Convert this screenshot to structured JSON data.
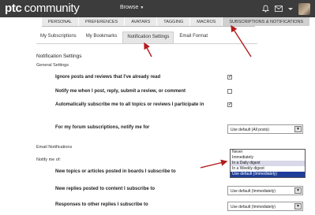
{
  "topbar": {
    "logo_ptc": "ptc",
    "logo_community": "community",
    "browse": "Browse",
    "browse_caret": "▼"
  },
  "subnav": {
    "items": [
      "PERSONAL",
      "PREFERENCES",
      "AVATARS",
      "TAGGING",
      "MACROS",
      "SUBSCRIPTIONS & NOTIFICATIONS"
    ]
  },
  "tabs": {
    "items": [
      "My Subscriptions",
      "My Bookmarks",
      "Notification Settings",
      "Email Format"
    ]
  },
  "notification_settings": {
    "title": "Notification Settings",
    "general": "General Settings",
    "rows": [
      {
        "label": "Ignore posts and reviews that I've already read",
        "checked": "✓"
      },
      {
        "label": "Notify me when I post, reply, submit a review, or comment",
        "checked": ""
      },
      {
        "label": "Automatically subscribe me to all topics or reviews I participate in",
        "checked": "✓"
      }
    ],
    "forum_label": "For my forum subscriptions, notify me for",
    "forum_value": "Use default (All posts)"
  },
  "email": {
    "title": "Email Notifications",
    "notify_of": "Notify me of:",
    "rows": [
      {
        "label": "New topics or articles posted in boards I subscribe to"
      },
      {
        "label": "New replies posted to content I subscribe to",
        "value": "Use default (Immediately)"
      },
      {
        "label": "Responses to other replies I subscribe to",
        "value": "Use default (Immediately)"
      }
    ],
    "dropdown_options": [
      "Never",
      "Immediately",
      "In a Daily digest",
      "In a Weekly digest",
      "Use default (Immediately)"
    ],
    "dropdown_selected": "Use default (Immediately)"
  },
  "select_arrow": "▼",
  "colors": {
    "topbar": "#3c3c3c",
    "selected_option": "#1e3e9a",
    "annotation_arrow": "#b31c1c"
  }
}
